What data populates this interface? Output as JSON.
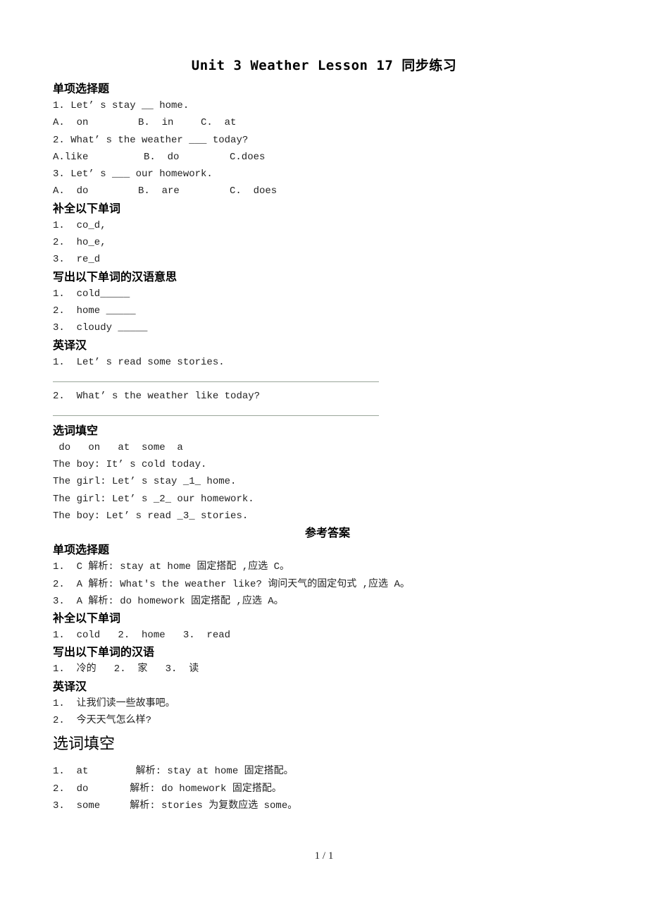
{
  "document": {
    "title": "Unit 3 Weather  Lesson 17  同步练习",
    "sections": {
      "single_choice": {
        "heading": "单项选择题",
        "questions": [
          {
            "stem": "1. Let’ s stay __ home.",
            "options": [
              "A.  on",
              "B.  in",
              "C.  at"
            ]
          },
          {
            "stem": "2. What’ s the weather ___ today?",
            "options": [
              "A.like",
              "B.  do",
              "C.does"
            ]
          },
          {
            "stem": "3. Let’ s ___ our homework.",
            "options": [
              "A.  do",
              "B.  are",
              "C.  does"
            ]
          }
        ]
      },
      "complete_words": {
        "heading": "补全以下单词",
        "items": [
          "1.  co_d,",
          "2.  ho_e,",
          "3.  re_d"
        ]
      },
      "chinese_meaning": {
        "heading": "写出以下单词的汉语意思",
        "items": [
          "1.  cold_____",
          "2.  home _____",
          "3.  cloudy _____"
        ]
      },
      "translate": {
        "heading": "英译汉",
        "items": [
          "1.  Let’ s read some stories.",
          "2.  What’ s the weather like today?"
        ]
      },
      "fill_blank": {
        "heading": "选词填空",
        "word_bank": " do   on   at  some  a",
        "lines": [
          "The boy: It’ s cold today.",
          "The girl: Let’ s stay _1_ home.",
          "The girl: Let’ s _2_ our homework.",
          "The boy: Let’ s read _3_ stories."
        ]
      }
    },
    "answers": {
      "heading": "参考答案",
      "single_choice": {
        "heading": "单项选择题",
        "items": [
          "1.  C 解析: stay at home 固定搭配 ,应选 C。",
          "2.  A 解析: What's the weather like? 询问天气的固定句式 ,应选 A。",
          "3.  A 解析: do homework 固定搭配 ,应选 A。"
        ]
      },
      "complete_words": {
        "heading": "补全以下单词",
        "line": "1.  cold   2.  home   3.  read"
      },
      "chinese_meaning": {
        "heading": "写出以下单词的汉语",
        "line": "1.  冷的   2.  家   3.  读"
      },
      "translate": {
        "heading": "英译汉",
        "items": [
          "1.  让我们读一些故事吧。",
          "2.  今天天气怎么样?"
        ]
      },
      "fill_blank": {
        "heading": "选词填空",
        "items": [
          "1.  at        解析: stay at home 固定搭配。",
          "2.  do       解析: do homework 固定搭配。",
          "3.  some     解析: stories 为复数应选 some。"
        ]
      }
    },
    "footer": {
      "page_number": "1 / 1"
    }
  }
}
